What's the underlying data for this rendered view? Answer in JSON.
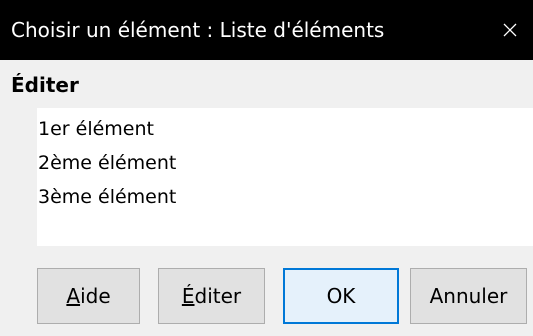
{
  "window": {
    "title": "Choisir un élément : Liste d'éléments"
  },
  "section": {
    "label": "Éditer"
  },
  "list": {
    "items": [
      "1er élément",
      "2ème élément",
      "3ème élément"
    ]
  },
  "buttons": {
    "help": {
      "label": "Aide",
      "mnemonic": "A",
      "rest": "ide"
    },
    "edit": {
      "label": "Éditer",
      "mnemonic": "É",
      "rest": "diter"
    },
    "ok": {
      "label": "OK"
    },
    "cancel": {
      "label": "Annuler"
    }
  },
  "colors": {
    "titlebar": "#000000",
    "background": "#f0f0f0",
    "accent": "#0078d7"
  },
  "icons": {
    "close": "close-icon"
  }
}
